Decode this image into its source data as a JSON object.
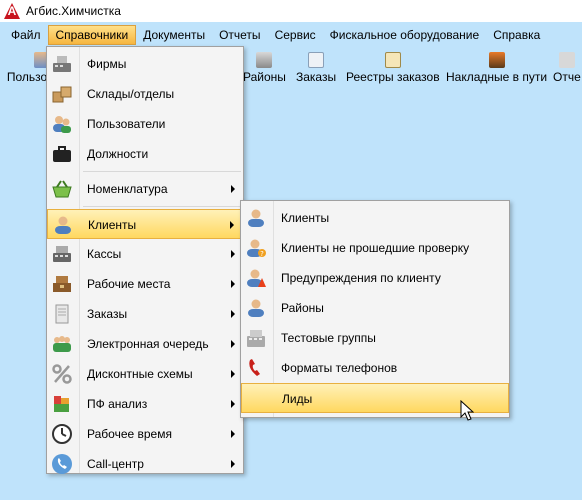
{
  "window": {
    "title": "Агбис.Химчистка",
    "logo_letter": "A"
  },
  "menubar": {
    "items": [
      "Файл",
      "Справочники",
      "Документы",
      "Отчеты",
      "Сервис",
      "Фискальное оборудование",
      "Справка"
    ]
  },
  "toolbar": {
    "items": [
      {
        "label": "Пользо",
        "icon": "users-icon"
      },
      {
        "label": "Районы",
        "icon": "districts-icon"
      },
      {
        "label": "Заказы",
        "icon": "orders-icon"
      },
      {
        "label": "Реестры заказов",
        "icon": "order-registers-icon"
      },
      {
        "label": "Накладные в пути",
        "icon": "truck-icon"
      },
      {
        "label": "Отче",
        "icon": "reports-icon"
      }
    ]
  },
  "menu": {
    "items": [
      {
        "label": "Фирмы",
        "icon": "cash-register-icon"
      },
      {
        "label": "Склады/отделы",
        "icon": "boxes-icon"
      },
      {
        "label": "Пользователи",
        "icon": "users-icon"
      },
      {
        "label": "Должности",
        "icon": "briefcase-icon"
      },
      {
        "label": "Номенклатура",
        "icon": "basket-icon"
      },
      {
        "label": "Клиенты",
        "icon": "client-icon"
      },
      {
        "label": "Кассы",
        "icon": "cash-register-icon"
      },
      {
        "label": "Рабочие места",
        "icon": "workplace-icon"
      },
      {
        "label": "Заказы",
        "icon": "orders-icon"
      },
      {
        "label": "Электронная очередь",
        "icon": "queue-icon"
      },
      {
        "label": "Дисконтные схемы",
        "icon": "percent-icon"
      },
      {
        "label": "ПФ анализ",
        "icon": "analysis-icon"
      },
      {
        "label": "Рабочее время",
        "icon": "clock-icon"
      },
      {
        "label": "Call-центр",
        "icon": "phone-icon"
      }
    ]
  },
  "submenu": {
    "items": [
      {
        "label": "Клиенты",
        "icon": "client-icon"
      },
      {
        "label": "Клиенты не прошедшие проверку",
        "icon": "client-warning-icon"
      },
      {
        "label": "Предупреждения по клиенту",
        "icon": "client-alert-icon"
      },
      {
        "label": "Районы",
        "icon": "districts-icon"
      },
      {
        "label": "Тестовые группы",
        "icon": "test-groups-icon"
      },
      {
        "label": "Форматы телефонов",
        "icon": "phone-format-icon"
      },
      {
        "label": "Лиды",
        "icon": ""
      }
    ]
  },
  "colors": {
    "background": "#bfe3fb",
    "highlight": "#ffd860",
    "logo": "#c8141e"
  }
}
